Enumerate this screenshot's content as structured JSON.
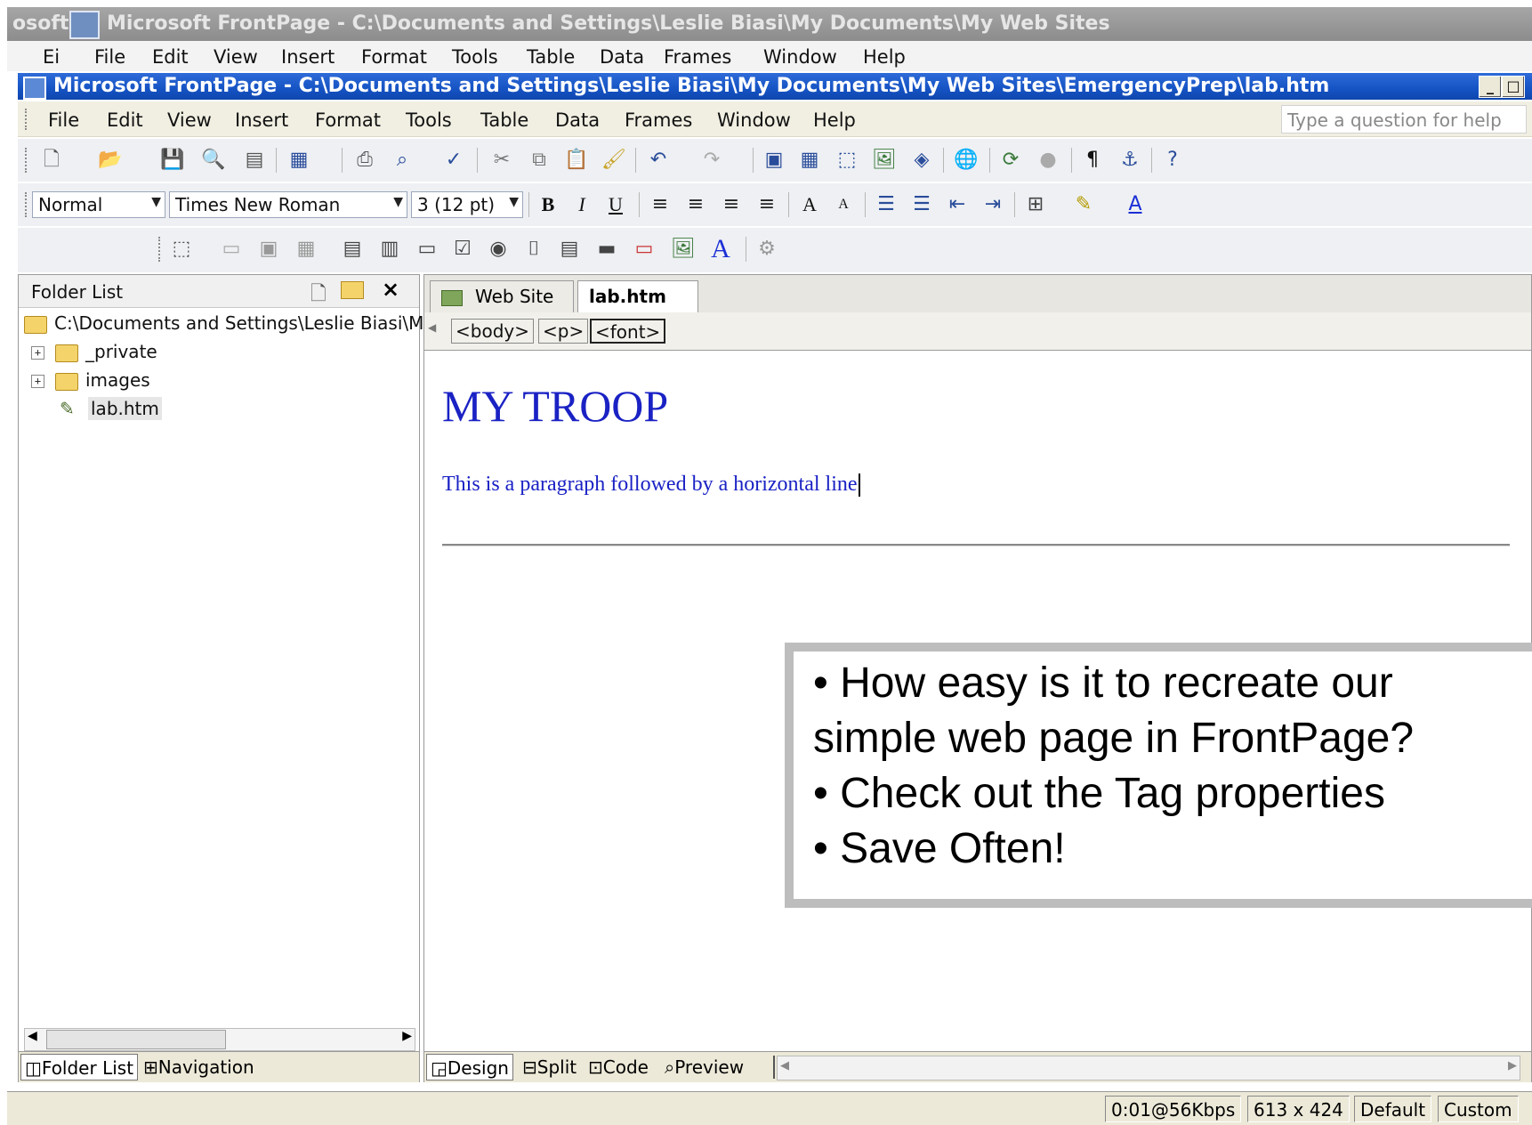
{
  "outer_window": {
    "title_left": "osoft",
    "title": "Microsoft FrontPage - C:\\Documents and Settings\\Leslie Biasi\\My Documents\\My Web Sites",
    "menu_fragment": "Ei",
    "menu": [
      "File",
      "Edit",
      "View",
      "Insert",
      "Format",
      "Tools",
      "Table",
      "Data",
      "Frames",
      "Window",
      "Help"
    ]
  },
  "window": {
    "title": "Microsoft FrontPage - C:\\Documents and Settings\\Leslie Biasi\\My Documents\\My Web Sites\\EmergencyPrep\\lab.htm",
    "menu": [
      "File",
      "Edit",
      "View",
      "Insert",
      "Format",
      "Tools",
      "Table",
      "Data",
      "Frames",
      "Window",
      "Help"
    ],
    "help_placeholder": "Type a question for help"
  },
  "format_toolbar": {
    "style": "Normal",
    "font": "Times New Roman",
    "size": "3  (12 pt)",
    "bold": "B",
    "italic": "I",
    "underline": "U"
  },
  "folder_list": {
    "title": "Folder List",
    "root": "C:\\Documents and Settings\\Leslie Biasi\\M",
    "items": [
      "_private",
      "images",
      "lab.htm"
    ],
    "tabs": [
      "Folder List",
      "Navigation"
    ]
  },
  "editor": {
    "tabs": [
      "Web Site",
      "lab.htm"
    ],
    "quick_tags": [
      "<body>",
      "<p>",
      "<font>"
    ],
    "heading": "MY TROOP",
    "paragraph": "This is a paragraph followed by a horizontal line",
    "view_tabs": [
      "Design",
      "Split",
      "Code",
      "Preview"
    ]
  },
  "status": {
    "download": "0:01@56Kbps",
    "size": "613 x 424",
    "mode": "Default",
    "css": "Custom"
  },
  "callout": {
    "bullets": [
      "• How easy is it to recreate our",
      "simple web page in FrontPage?",
      "• Check out the Tag properties",
      "• Save Often!"
    ]
  },
  "colors": {
    "title_bar": "#1553c4",
    "page_text": "#1a22c4",
    "callout_border": "#bdbdbd"
  }
}
